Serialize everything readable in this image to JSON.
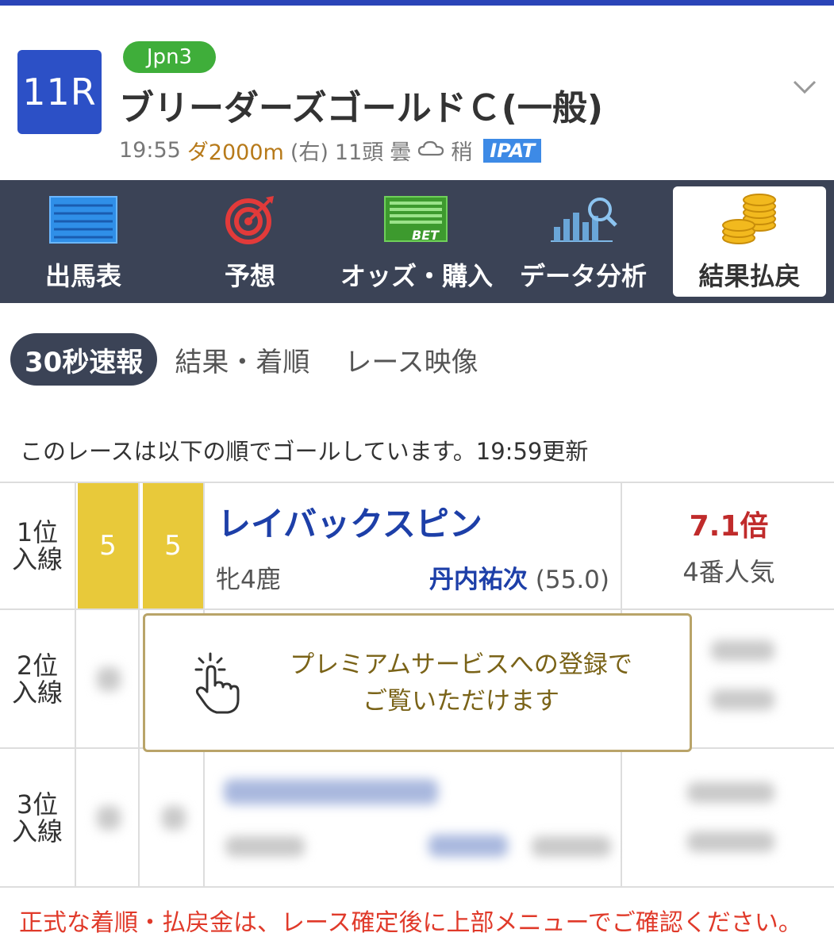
{
  "header": {
    "race_no": "11R",
    "grade": "Jpn3",
    "title": "ブリーダーズゴールドＣ(一般)",
    "time": "19:55",
    "distance": "ダ2000m",
    "direction": "(右)",
    "runners": "11頭",
    "weather": "曇",
    "going": "稍",
    "ipat": "IPAT"
  },
  "menu": [
    {
      "label": "出馬表",
      "icon": "race-card-icon"
    },
    {
      "label": "予想",
      "icon": "target-icon"
    },
    {
      "label": "オッズ・購入",
      "icon": "bet-sheet-icon"
    },
    {
      "label": "データ分析",
      "icon": "chart-search-icon"
    },
    {
      "label": "結果払戻",
      "icon": "coins-icon",
      "active": true
    }
  ],
  "subtabs": [
    "30秒速報",
    "結果・着順",
    "レース映像"
  ],
  "notice": "このレースは以下の順でゴールしています。19:59更新",
  "results": [
    {
      "rank_line1": "1位",
      "rank_line2": "入線",
      "waku": "5",
      "number": "5",
      "horse": "レイバックスピン",
      "sex_age": "牝4鹿",
      "jockey": "丹内祐次",
      "weight": "(55.0)",
      "odds": "7.1倍",
      "popularity": "4番人気"
    },
    {
      "rank_line1": "2位",
      "rank_line2": "入線"
    },
    {
      "rank_line1": "3位",
      "rank_line2": "入線"
    }
  ],
  "premium": {
    "line1": "プレミアムサービスへの登録で",
    "line2": "ご覧いただけます"
  },
  "footer_note": "正式な着順・払戻金は、レース確定後に上部メニューでご確認ください。",
  "colors": {
    "accent_blue": "#2c50c6",
    "menu_bg": "#3b4356",
    "waku_yellow": "#e8c93a",
    "odds_red": "#c02b2b",
    "premium_gold": "#b9a469",
    "footer_red": "#e03a2a"
  }
}
